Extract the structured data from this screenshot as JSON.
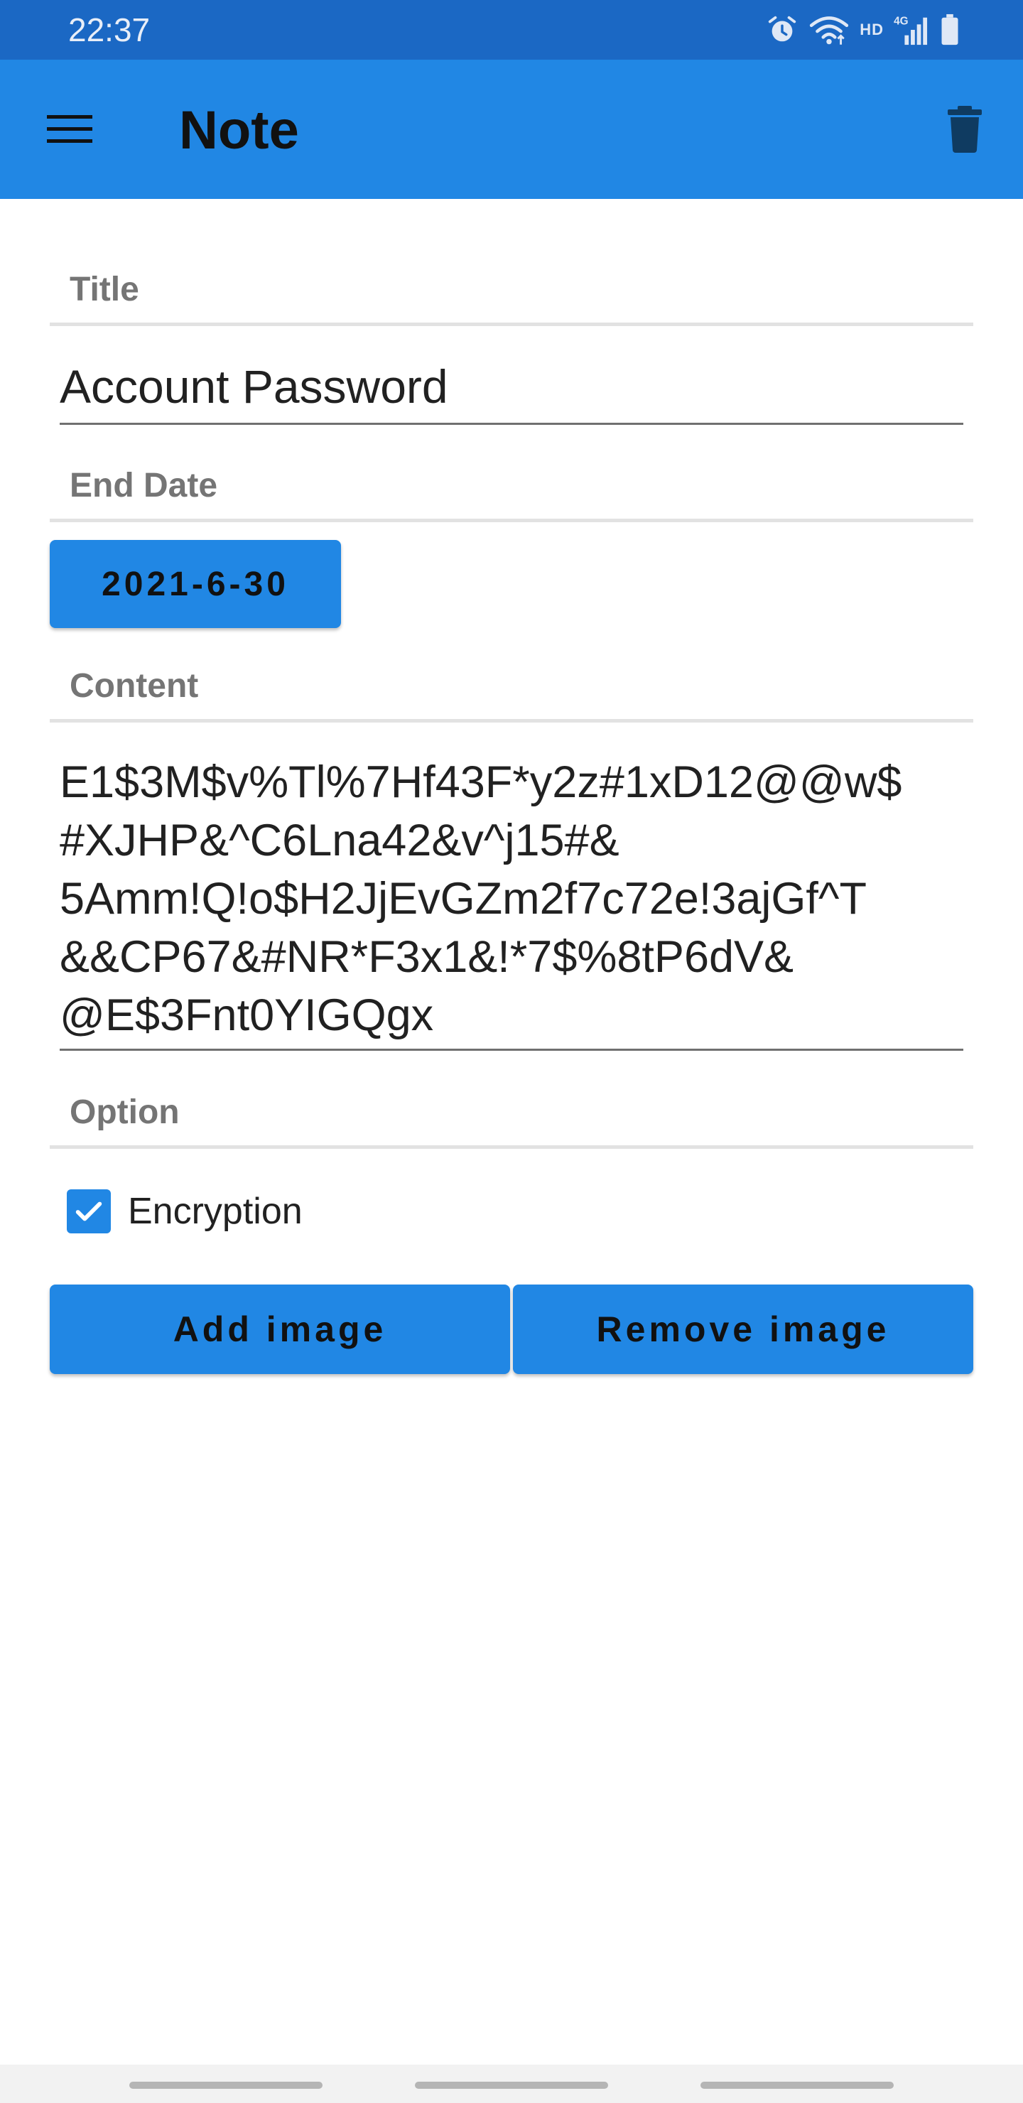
{
  "status_bar": {
    "time": "22:37",
    "network_label": "HD",
    "network_type": "4G"
  },
  "app_bar": {
    "title": "Note",
    "menu_icon": "hamburger-menu-icon",
    "delete_icon": "trash-icon"
  },
  "form": {
    "title_label": "Title",
    "title_value": "Account Password",
    "end_date_label": "End Date",
    "end_date_value": "2021-6-30",
    "content_label": "Content",
    "content_lines": [
      "E1$3M$v%Tl%7Hf43F*y2z#1xD12@@w$",
      "#XJHP&^C6Lna42&v^j15#&",
      "5Amm!Q!o$H2JjEvGZm2f7c72e!3ajGf^T",
      "&&CP67&#NR*F3x1&!*7$%8tP6dV&",
      "@E$3Fnt0YIGQgx"
    ],
    "option_label": "Option",
    "encryption_label": "Encryption",
    "encryption_checked": true
  },
  "actions": {
    "add_image": "Add image",
    "remove_image": "Remove image"
  },
  "colors": {
    "status_bar": "#1b68c4",
    "app_bar": "#2187e4",
    "accent": "#2187e4",
    "label": "#757575"
  }
}
